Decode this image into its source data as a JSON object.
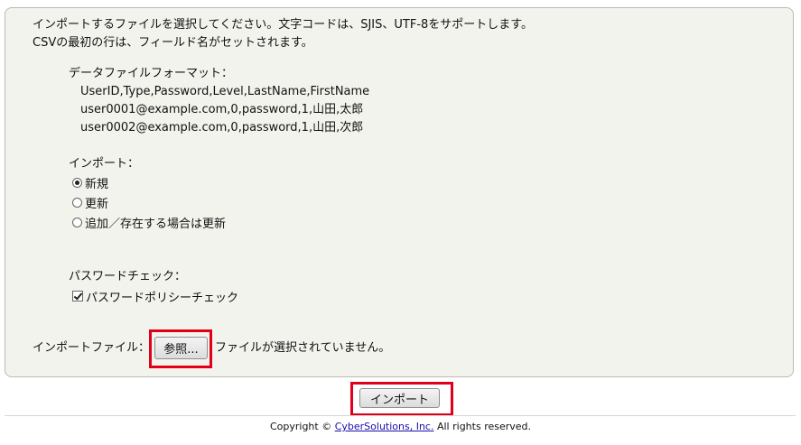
{
  "intro": {
    "line1": "インポートするファイルを選択してください。文字コードは、SJIS、UTF-8をサポートします。",
    "line2": "CSVの最初の行は、フィールド名がセットされます。"
  },
  "format": {
    "label": "データファイルフォーマット：",
    "lines": [
      "UserID,Type,Password,Level,LastName,FirstName",
      "user0001@example.com,0,password,1,山田,太郎",
      "user0002@example.com,0,password,1,山田,次郎"
    ]
  },
  "import_mode": {
    "label": "インポート：",
    "options": [
      {
        "label": "新規",
        "checked": true
      },
      {
        "label": "更新",
        "checked": false
      },
      {
        "label": "追加／存在する場合は更新",
        "checked": false
      }
    ]
  },
  "password_check": {
    "label": "パスワードチェック：",
    "checkbox_label": "パスワードポリシーチェック",
    "checked": true
  },
  "file": {
    "label": "インポートファイル：",
    "browse_label": "参照...",
    "status": "ファイルが選択されていません。"
  },
  "import_button": "インポート",
  "footer": {
    "prefix": "Copyright © ",
    "company": "CyberSolutions, Inc.",
    "suffix": " All rights reserved."
  },
  "colors": {
    "highlight": "#e0001a",
    "panel_bg": "#f3f3ee"
  }
}
